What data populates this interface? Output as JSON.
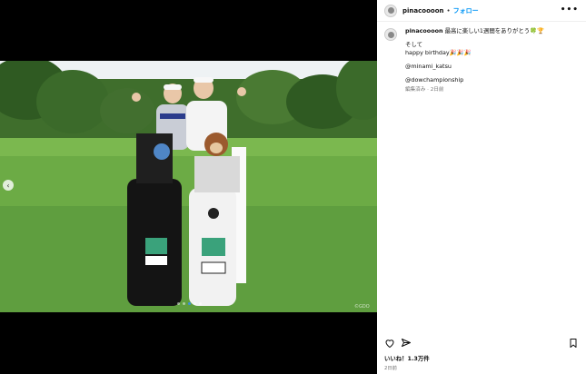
{
  "header": {
    "username": "pinacoooon",
    "separator": "•",
    "follow_label": "フォロー",
    "more_label": "•••"
  },
  "caption": {
    "username": "pinacoooon",
    "line1": "最高に楽しい1週間をありがとう🍀🏆",
    "line2": "そして",
    "line3": "happy birthday🎉🎉🎉",
    "mention": "@minami_katsu",
    "mention2": "@dowchampionship",
    "meta": "編集済み · 2日前"
  },
  "media": {
    "credit": "©GDO",
    "prev_icon": "‹",
    "carousel_count": 5,
    "active_index": 2
  },
  "footer": {
    "likes": "いいね！1.3万件",
    "date": "2日前"
  },
  "colors": {
    "accent": "#0095f6",
    "grass": "#5f9e3f",
    "sky": "#eef2f4"
  }
}
